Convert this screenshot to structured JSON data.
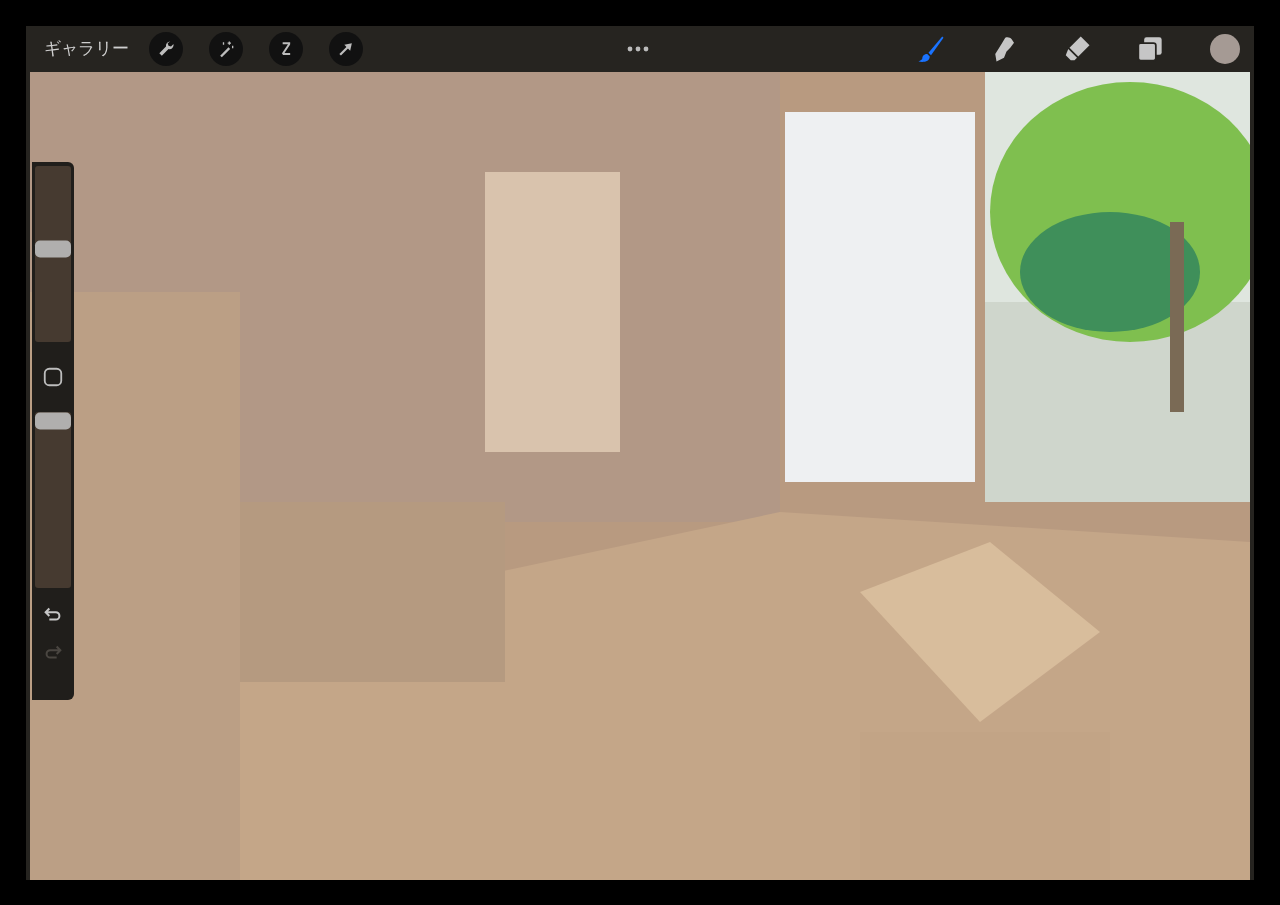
{
  "top_bar": {
    "gallery_label": "ギャラリー",
    "actions": [
      {
        "kind": "wrench"
      },
      {
        "kind": "magic"
      },
      {
        "kind": "selection"
      },
      {
        "kind": "transform"
      }
    ],
    "tools": [
      {
        "kind": "brush",
        "selected": true
      },
      {
        "kind": "smudge",
        "selected": false
      },
      {
        "kind": "eraser",
        "selected": false
      }
    ],
    "current_color": {
      "color": "#a59a94"
    }
  },
  "sidebar": {
    "size_slider": {
      "level": 0.53
    },
    "opacity_slider": {
      "level": 0.95
    },
    "undo": {
      "disabled": false
    },
    "redo": {
      "disabled": true
    }
  }
}
